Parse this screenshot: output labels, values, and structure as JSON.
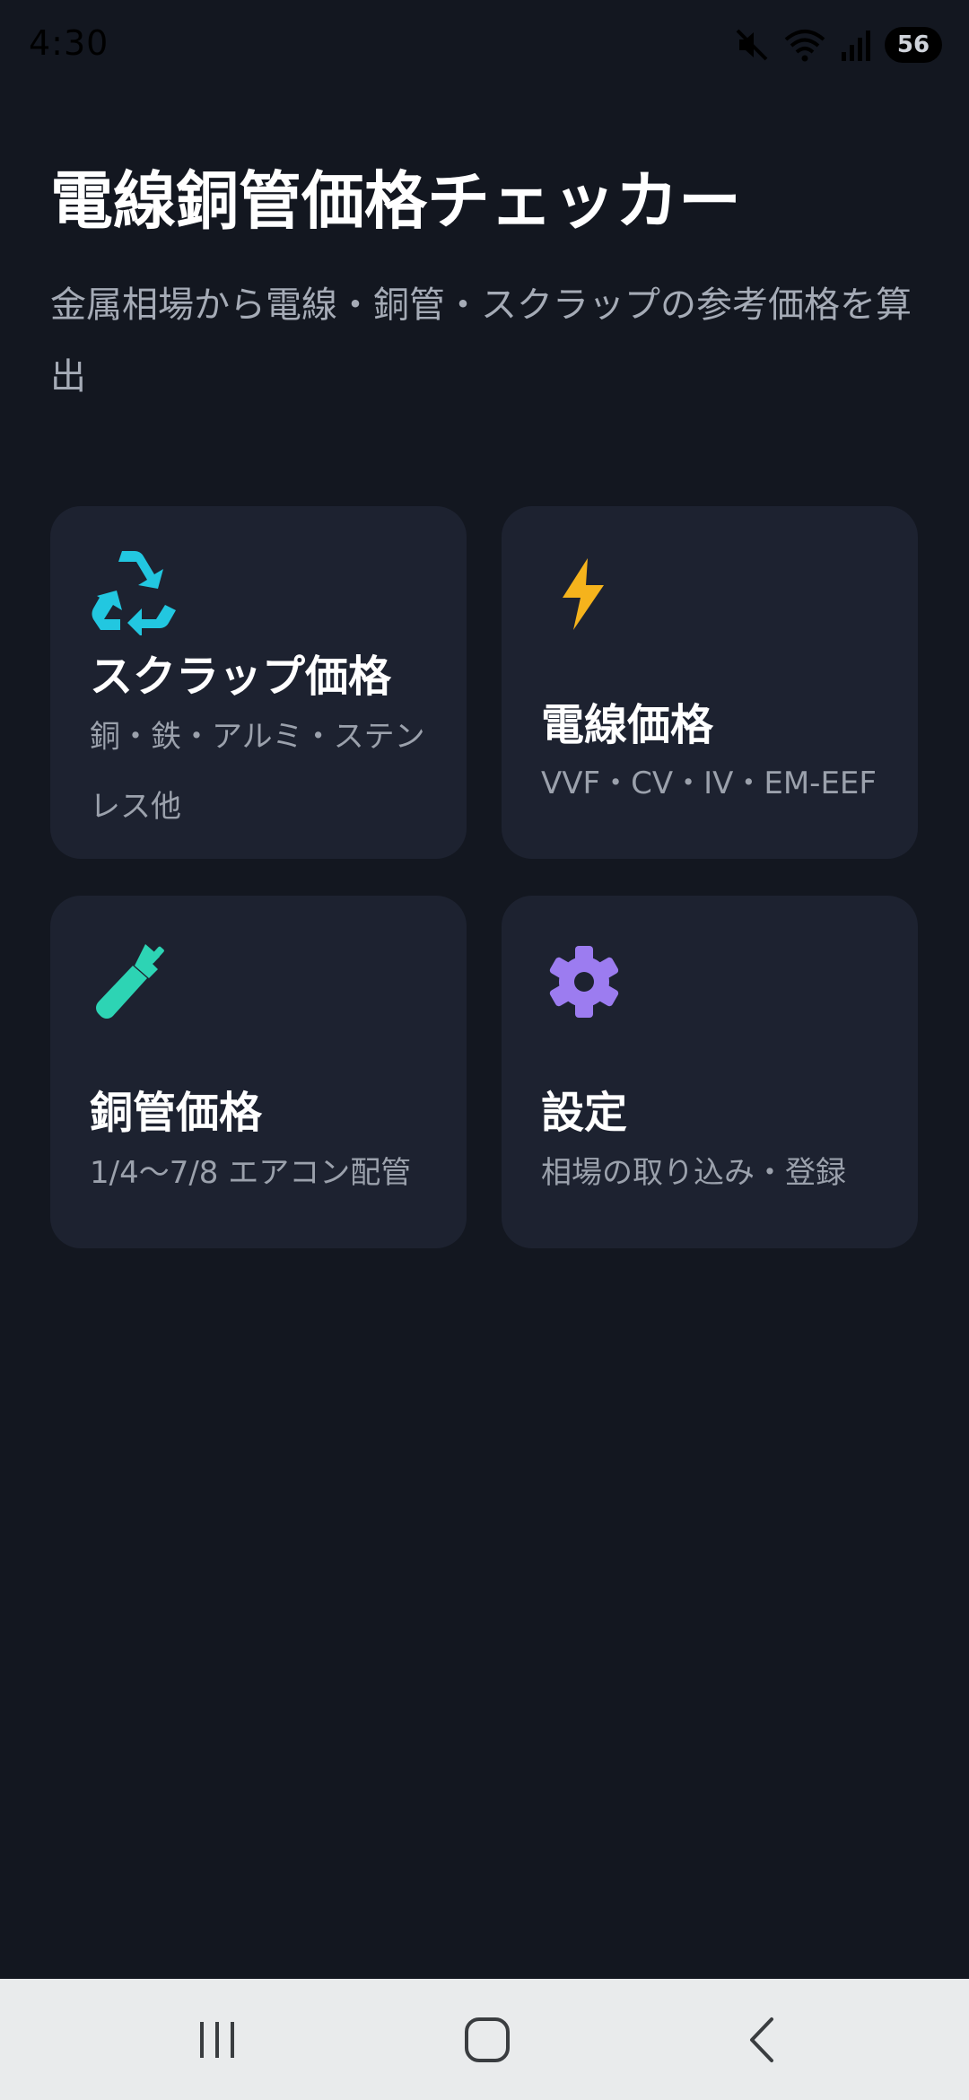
{
  "status_bar": {
    "time": "4:30",
    "battery": "56"
  },
  "header": {
    "title": "電線銅管価格チェッカー",
    "subtitle": "金属相場から電線・銅管・スクラップの参考価格を算出"
  },
  "cards": [
    {
      "id": "scrap",
      "icon": "recycle-icon",
      "color": "#22c7e0",
      "title": "スクラップ価格",
      "description": "銅・鉄・アルミ・ステンレス他"
    },
    {
      "id": "wire",
      "icon": "lightning-icon",
      "color": "#f5b31c",
      "title": "電線価格",
      "description": "VVF・CV・IV・EM-EEF"
    },
    {
      "id": "copper-pipe",
      "icon": "wrench-icon",
      "color": "#2dd4b4",
      "title": "銅管価格",
      "description": "1/4〜7/8 エアコン配管"
    },
    {
      "id": "settings",
      "icon": "gear-icon",
      "color": "#9c7cf0",
      "title": "設定",
      "description": "相場の取り込み・登録"
    }
  ],
  "nav_bar": {
    "buttons": [
      "recent-apps-icon",
      "home-icon",
      "back-icon"
    ]
  }
}
